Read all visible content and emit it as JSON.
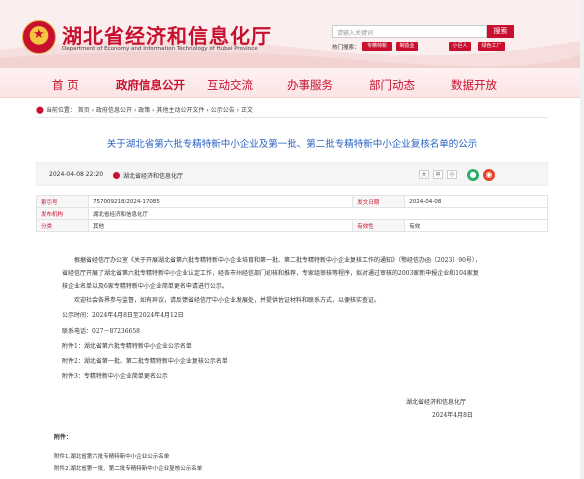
{
  "header": {
    "title": "湖北省经济和信息化厅",
    "subtitle": "Department of Economy and Information Technology of Hubei Province",
    "search_placeholder": "请输入关键词",
    "search_button": "搜索",
    "hot_label": "热门搜索：",
    "hot_tags": [
      "专精特新",
      "制造业",
      "小巨人",
      "绿色工厂"
    ]
  },
  "nav": [
    "首 页",
    "政府信息公开",
    "互动交流",
    "办事服务",
    "部门动态",
    "数据开放"
  ],
  "breadcrumb": {
    "prefix": "当前位置：",
    "items": [
      "首页",
      "政府信息公开",
      "政策",
      "其他主动公开文件",
      "公示公告",
      "正文"
    ]
  },
  "article": {
    "title": "关于湖北省第六批专精特新中小企业及第一批、第二批专精特新中小企业复核名单的公示",
    "date": "2024-04-08 22:20",
    "source": "湖北省经济和信息化厅",
    "font_controls": [
      "大",
      "中",
      "小"
    ],
    "info": {
      "index_label": "索引号",
      "index_value": "757009218/2024-17085",
      "pubdate_label": "发文日期",
      "pubdate_value": "2024-04-08",
      "org_label": "发布机构",
      "org_value": "湖北省经济和信息化厅",
      "category_label": "分类",
      "category_value": "其他",
      "validity_label": "有效性",
      "validity_value": "有效"
    },
    "body": {
      "p1": "根据省经信厅办公室《关于开展湖北省第六批专精特新中小企业培育和第一批、第二批专精特新中小企业复核工作的通知》（鄂经信办函〔2023〕90号），省经信厅开展了湖北省第六批专精特新中小企业认定工作，经各市州经信部门初核和推荐，专家组审核等程序，拟对通过审核的2003家新申报企业和104家复核企业名单以及6家专精特新中小企业简单更名申请进行公示。",
      "p2": "欢迎社会各界参与监督，如有异议，请反馈省经信厅中小企业发展处，并提供佐证材料和联系方式，以便核实查证。",
      "period": "公示时间：2024年4月8日至2024年4月12日",
      "phone": "联系电话：027－87236658",
      "att1": "附件1：湖北省第六批专精特新中小企业公示名单",
      "att2": "附件2：湖北省第一批、第二批专精特新中小企业复核公示名单",
      "att3": "附件3：专精特新中小企业简单更名公示"
    },
    "signature": "湖北省经济和信息化厅",
    "sign_date": "2024年4月8日",
    "attachments_head": "附件：",
    "attachments": [
      "附件1.湖北省第六批专精特新中小企业公示名单",
      "附件2.湖北省第一批、第二批专精特新中小企业复核公示名单"
    ]
  },
  "colors": {
    "brand": "#c8102e",
    "title": "#2a62c0"
  }
}
